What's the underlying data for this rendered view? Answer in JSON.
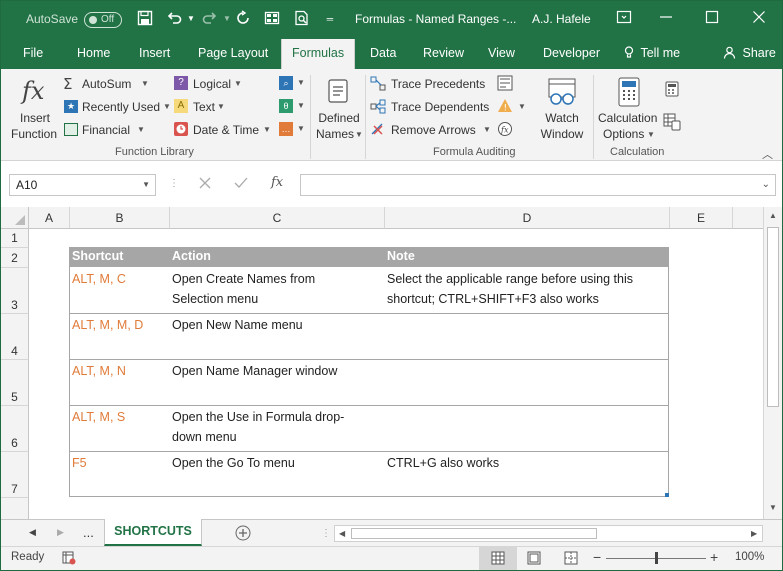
{
  "titlebar": {
    "autosave_label": "AutoSave",
    "autosave_state": "Off",
    "title": "Formulas - Named Ranges  -...",
    "user": "A.J. Hafele"
  },
  "tabs": [
    "File",
    "Home",
    "Insert",
    "Page Layout",
    "Formulas",
    "Data",
    "Review",
    "View",
    "Developer"
  ],
  "active_tab": "Formulas",
  "tell_me": "Tell me",
  "share": "Share",
  "ribbon": {
    "insert_function": [
      "Insert",
      "Function"
    ],
    "autosum": "AutoSum",
    "recently_used": "Recently Used",
    "financial": "Financial",
    "logical": "Logical",
    "text": "Text",
    "date_time": "Date & Time",
    "group_function_library": "Function Library",
    "defined_names": [
      "Defined",
      "Names"
    ],
    "trace_precedents": "Trace Precedents",
    "trace_dependents": "Trace Dependents",
    "remove_arrows": "Remove Arrows",
    "watch_window": [
      "Watch",
      "Window"
    ],
    "group_formula_auditing": "Formula Auditing",
    "calculation_options": [
      "Calculation",
      "Options"
    ],
    "group_calculation": "Calculation"
  },
  "formula_bar": {
    "name_box": "A10",
    "fx": "fx",
    "value": ""
  },
  "columns": [
    "A",
    "B",
    "C",
    "D",
    "E"
  ],
  "rows": [
    "1",
    "2",
    "3",
    "4",
    "5",
    "6",
    "7"
  ],
  "table": {
    "headers": [
      "Shortcut",
      "Action",
      "Note"
    ],
    "rows": [
      {
        "shortcut": "ALT, M, C",
        "action": [
          "Open Create Names from",
          "Selection menu"
        ],
        "note": [
          "Select the applicable range before using this",
          "shortcut; CTRL+SHIFT+F3 also works"
        ]
      },
      {
        "shortcut": "ALT, M, M, D",
        "action": [
          "Open New Name menu"
        ],
        "note": []
      },
      {
        "shortcut": "ALT, M, N",
        "action": [
          "Open Name Manager window"
        ],
        "note": []
      },
      {
        "shortcut": "ALT, M, S",
        "action": [
          "Open the Use in Formula drop-",
          "down menu"
        ],
        "note": []
      },
      {
        "shortcut": "F5",
        "action": [
          "Open the Go To menu"
        ],
        "note": [
          "CTRL+G also works"
        ]
      }
    ]
  },
  "sheets": {
    "ellipsis": "...",
    "active": "SHORTCUTS"
  },
  "status": {
    "ready": "Ready",
    "zoom": "100%"
  },
  "colors": {
    "accent": "#217346",
    "shortcut_text": "#e07b39",
    "header_band": "#a6a6a6"
  }
}
